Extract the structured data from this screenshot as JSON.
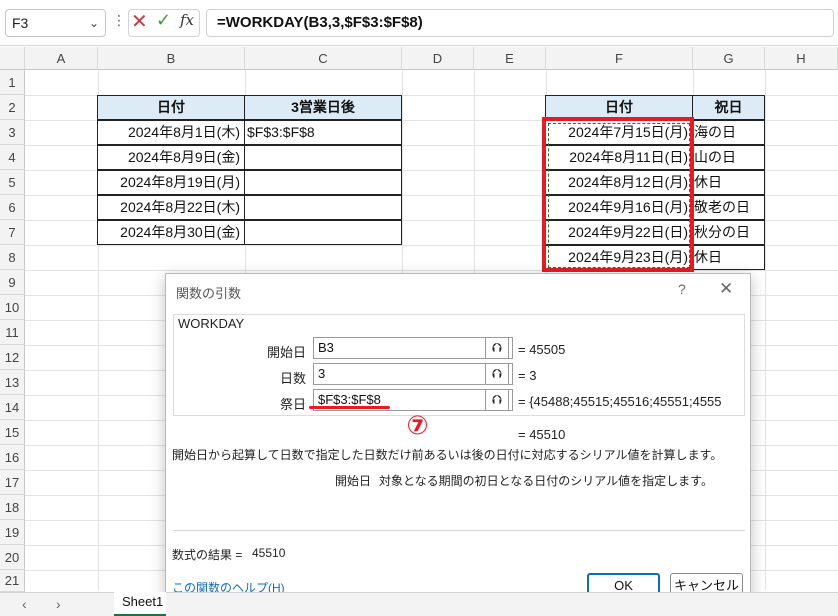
{
  "formula_bar": {
    "name_box": "F3",
    "formula": "=WORKDAY(B3,3,$F$3:$F$8)",
    "cancel_icon": "✕",
    "enter_icon": "✓",
    "fx_label": "fx"
  },
  "columns": [
    "A",
    "B",
    "C",
    "D",
    "E",
    "F",
    "G",
    "H"
  ],
  "rows": [
    "1",
    "2",
    "3",
    "4",
    "5",
    "6",
    "7",
    "8",
    "9",
    "10",
    "11",
    "12",
    "13",
    "14",
    "15",
    "16",
    "17",
    "18",
    "19",
    "20",
    "21"
  ],
  "table1": {
    "headers": [
      "日付",
      "3営業日後"
    ],
    "dates": [
      "2024年8月1日(木)",
      "2024年8月9日(金)",
      "2024年8月19日(月)",
      "2024年8月22日(木)",
      "2024年8月30日(金)"
    ],
    "c3_value": "$F$3:$F$8"
  },
  "table2": {
    "headers": [
      "日付",
      "祝日"
    ],
    "dates": [
      "2024年7月15日(月)",
      "2024年8月11日(日)",
      "2024年8月12日(月)",
      "2024年9月16日(月)",
      "2024年9月22日(日)",
      "2024年9月23日(月)"
    ],
    "holidays": [
      "海の日",
      "山の日",
      "休日",
      "敬老の日",
      "秋分の日",
      "休日"
    ]
  },
  "dialog": {
    "title": "関数の引数",
    "help_q": "?",
    "close": "✕",
    "function_name": "WORKDAY",
    "args": [
      {
        "label": "開始日",
        "value": "B3",
        "result": "=  45505"
      },
      {
        "label": "日数",
        "value": "3",
        "result": "=  3"
      },
      {
        "label": "祭日",
        "value": "$F$3:$F$8",
        "result": "=  {45488;45515;45516;45551;4555"
      }
    ],
    "ref_icon": "⮉",
    "overall_result": "=  45510",
    "description": "開始日から起算して日数で指定した日数だけ前あるいは後の日付に対応するシリアル値を計算します。",
    "arg_help_name": "開始日",
    "arg_help_text": "対象となる期間の初日となる日付のシリアル値を指定します。",
    "formula_result_label": "数式の結果 =",
    "formula_result_value": "45510",
    "help_link": "この関数のヘルプ(H)",
    "ok_label": "OK",
    "cancel_label": "キャンセル"
  },
  "annotation": {
    "number": "⑦"
  },
  "sheet_tab": "Sheet1",
  "colors": {
    "accent_red": "#e51c23",
    "header_fill": "#ddebf7",
    "link_blue": "#0f6cbd"
  }
}
